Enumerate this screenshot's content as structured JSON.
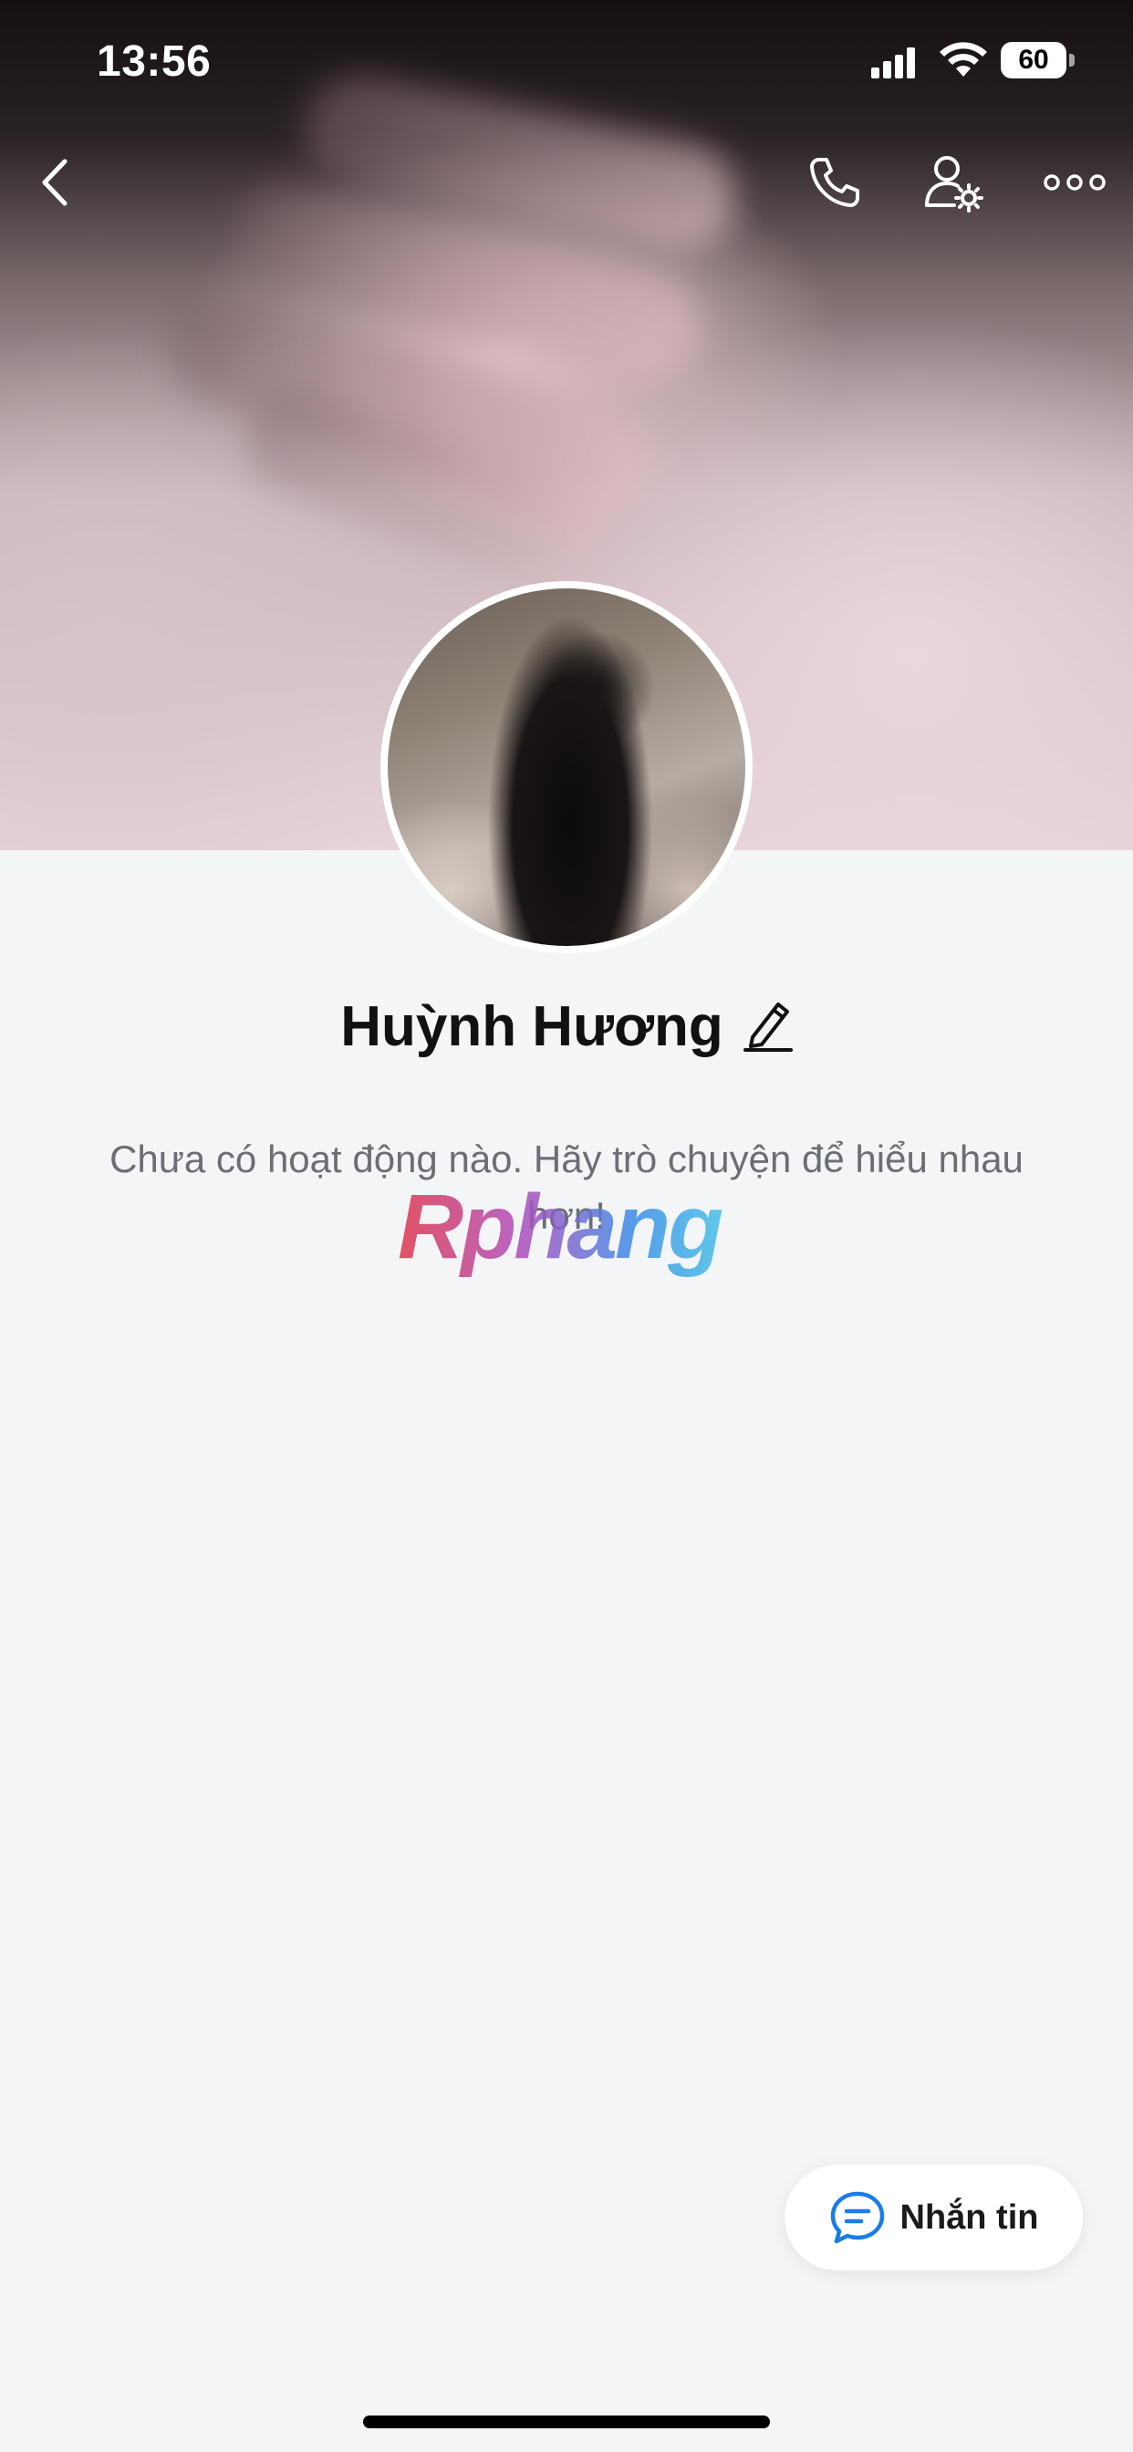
{
  "status_bar": {
    "time": "13:56",
    "battery": "60"
  },
  "header": {
    "back_icon": "chevron-left-icon",
    "actions": [
      "phone-icon",
      "user-settings-icon",
      "more-icon"
    ]
  },
  "profile": {
    "name": "Huỳnh Hương",
    "edit_icon": "pencil-icon"
  },
  "feed": {
    "empty_message": "Chưa có hoạt động nào. Hãy trò chuyện để hiểu nhau hơn!"
  },
  "watermark": "Rphang",
  "message_button": {
    "label": "Nhắn tin",
    "icon": "chat-icon",
    "accent": "#1a7de8"
  }
}
